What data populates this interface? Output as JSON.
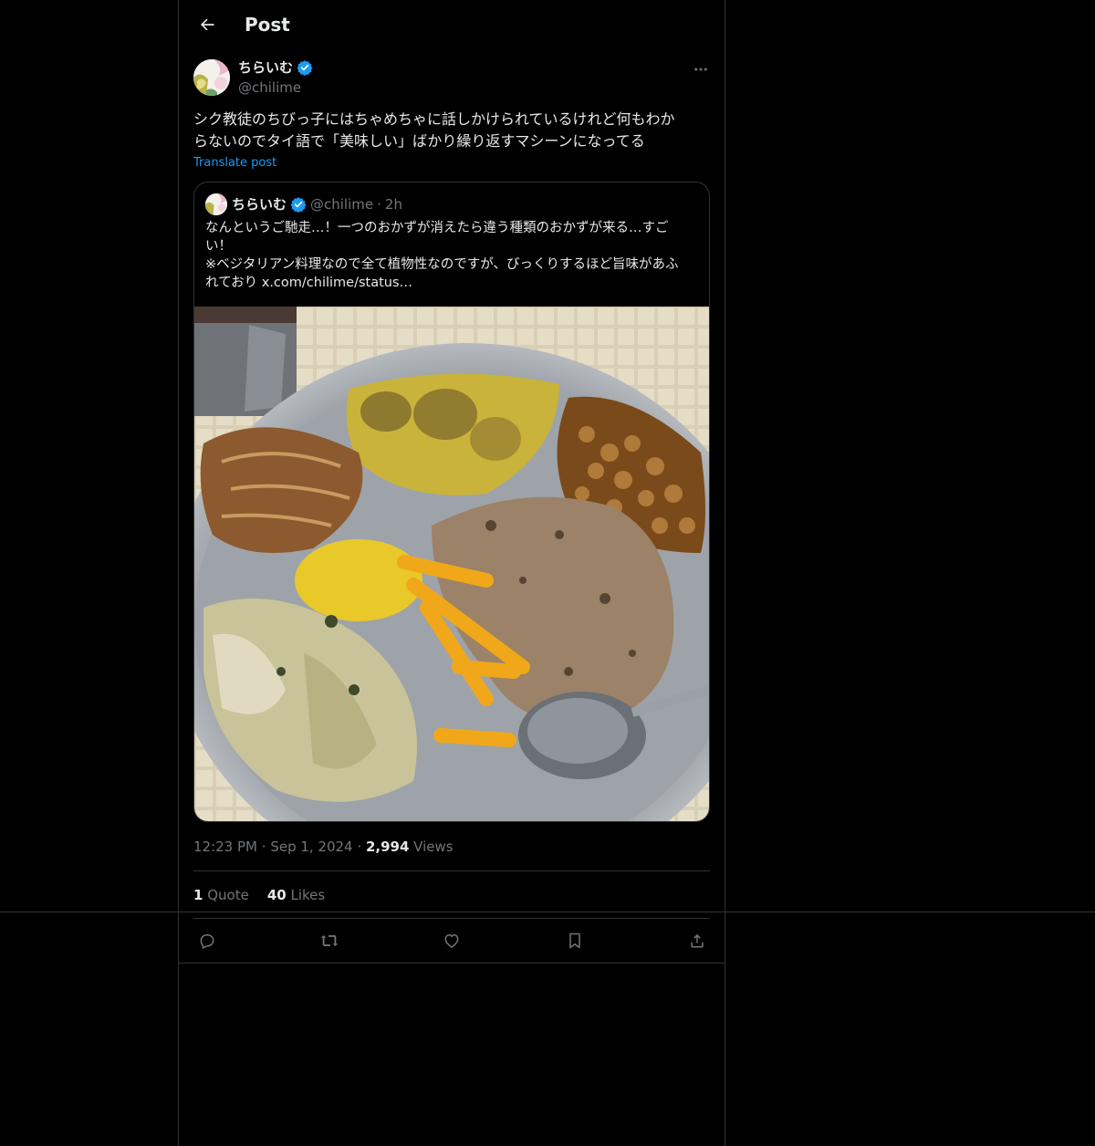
{
  "header": {
    "title": "Post",
    "back_icon": "arrow-left-icon"
  },
  "post": {
    "author_name": "ちらいむ",
    "author_handle": "@chilime",
    "verified": true,
    "text": "シク教徒のちびっ子にはちゃめちゃに話しかけられているけれど何もわか\nらないのでタイ語で「美味しい」ばかり繰り返すマシーンになってる",
    "translate_label": "Translate post",
    "time": "12:23 PM",
    "date": "Sep 1, 2024",
    "views_count": "2,994",
    "views_label": "Views",
    "quote_count": "1",
    "quote_label": "Quote",
    "likes_count": "40",
    "likes_label": "Likes"
  },
  "quoted": {
    "author_name": "ちらいむ",
    "author_handle": "@chilime",
    "age": "2h",
    "text": "なんというご馳走…！一つのおかずが消えたら違う種類のおかずが来る…すご\nい！\n※ベジタリアン料理なので全て植物性なのですが、びっくりするほど旨味があふ\nれており x.com/chilime/status…"
  },
  "actions": [
    "reply-icon",
    "repost-icon",
    "like-icon",
    "bookmark-icon",
    "share-icon"
  ],
  "colors": {
    "background": "#000000",
    "text": "#e7e9ea",
    "muted": "#71767b",
    "accent": "#1d9bf0",
    "border": "#2f3336"
  }
}
